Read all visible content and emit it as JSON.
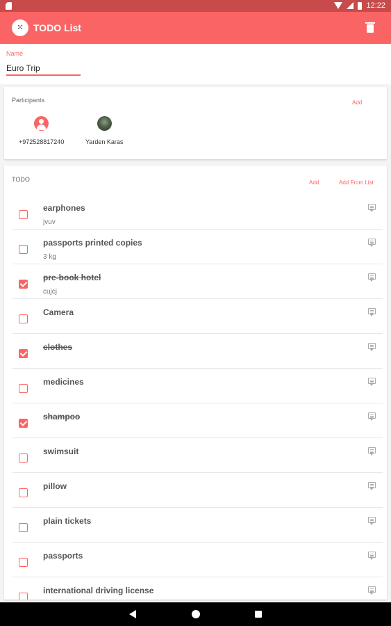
{
  "status_bar": {
    "time": "12:22"
  },
  "app_bar": {
    "title": "TODO List",
    "app_icon": "dice-icon",
    "delete_icon": "trash-icon"
  },
  "name_field": {
    "label": "Name",
    "value": "Euro Trip"
  },
  "participants": {
    "title": "Participants",
    "add_label": "Add",
    "people": [
      {
        "name": "+972528817240",
        "avatar": "default-person-icon"
      },
      {
        "name": "Yarden Karas",
        "avatar": "photo"
      }
    ]
  },
  "todo": {
    "title": "TODO",
    "add_label": "Add",
    "add_from_list_label": "Add From List",
    "items": [
      {
        "title": "earphones",
        "note": "jvuv",
        "checked": false
      },
      {
        "title": "passports printed copies",
        "note": "3 kg",
        "checked": false
      },
      {
        "title": "pre-book hotel",
        "note": "cujcj",
        "checked": true
      },
      {
        "title": "Camera",
        "note": "",
        "checked": false
      },
      {
        "title": "clothes",
        "note": "",
        "checked": true
      },
      {
        "title": "medicines",
        "note": "",
        "checked": false
      },
      {
        "title": "shampoo",
        "note": "",
        "checked": true
      },
      {
        "title": "swimsuit",
        "note": "",
        "checked": false
      },
      {
        "title": "pillow",
        "note": "",
        "checked": false
      },
      {
        "title": "plain tickets",
        "note": "",
        "checked": false
      },
      {
        "title": "passports",
        "note": "",
        "checked": false
      },
      {
        "title": "international driving license",
        "note": "",
        "checked": false
      }
    ]
  },
  "colors": {
    "accent": "#fb6464",
    "status_bar": "#c94a4a"
  }
}
